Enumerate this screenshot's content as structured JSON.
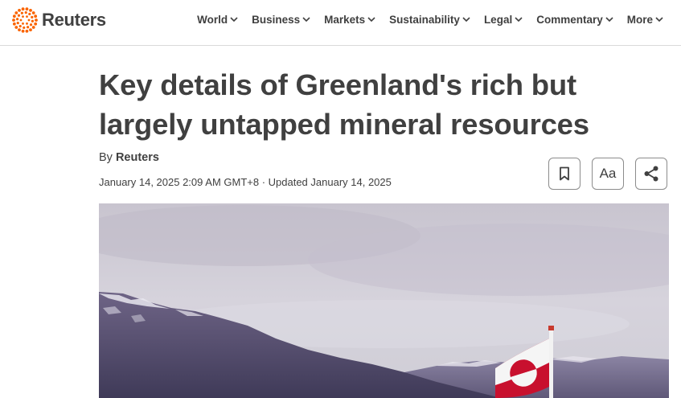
{
  "brand": {
    "name": "Reuters",
    "logo_color": "#fa6400"
  },
  "nav": {
    "items": [
      {
        "label": "World"
      },
      {
        "label": "Business"
      },
      {
        "label": "Markets"
      },
      {
        "label": "Sustainability"
      },
      {
        "label": "Legal"
      },
      {
        "label": "Commentary"
      },
      {
        "label": "More"
      }
    ],
    "chevron_icon": "chevron-down-icon"
  },
  "article": {
    "headline_line1": "Key details of Greenland's rich but",
    "headline_line2": "largely untapped mineral resources",
    "byline_prefix": "By",
    "byline_author": "Reuters",
    "dateline": "January 14, 2025 2:09 AM GMT+8 · Updated January 14, 2025"
  },
  "actions": {
    "bookmark_icon": "bookmark-icon",
    "text_size_label": "Aa",
    "share_icon": "share-icon"
  },
  "hero_image": {
    "subject": "greenland-flag-mountains",
    "flag_colors": [
      "#c8102e",
      "#ffffff"
    ]
  }
}
